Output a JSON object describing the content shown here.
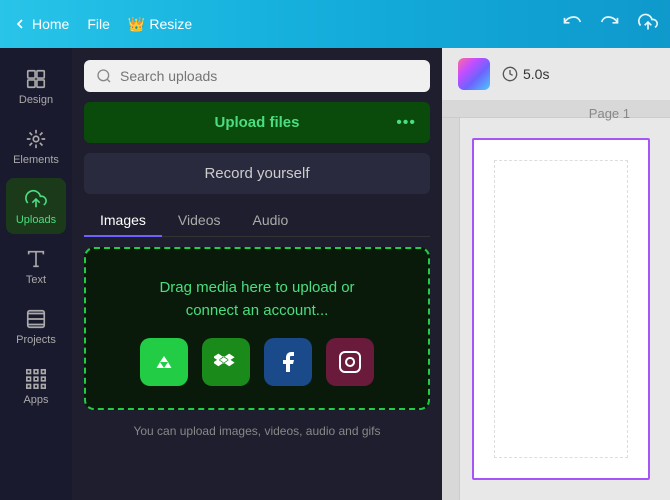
{
  "topbar": {
    "back_label": "Home",
    "file_label": "File",
    "resize_label": "Resize",
    "crown_emoji": "👑"
  },
  "sidebar": {
    "items": [
      {
        "id": "design",
        "label": "Design",
        "active": false
      },
      {
        "id": "elements",
        "label": "Elements",
        "active": false
      },
      {
        "id": "uploads",
        "label": "Uploads",
        "active": true
      },
      {
        "id": "text",
        "label": "Text",
        "active": false
      },
      {
        "id": "projects",
        "label": "Projects",
        "active": false
      },
      {
        "id": "apps",
        "label": "Apps",
        "active": false
      }
    ]
  },
  "panel": {
    "search_placeholder": "Search uploads",
    "upload_btn_label": "Upload files",
    "upload_btn_dots": "•••",
    "record_btn_label": "Record yourself",
    "tabs": [
      {
        "id": "images",
        "label": "Images",
        "active": true
      },
      {
        "id": "videos",
        "label": "Videos",
        "active": false
      },
      {
        "id": "audio",
        "label": "Audio",
        "active": false
      }
    ],
    "drop_text": "Drag media here to upload or\nconnect an account...",
    "footer_text": "You can upload images, videos, audio and gifs"
  },
  "canvas": {
    "time_label": "5.0s",
    "page_label": "Page 1"
  }
}
